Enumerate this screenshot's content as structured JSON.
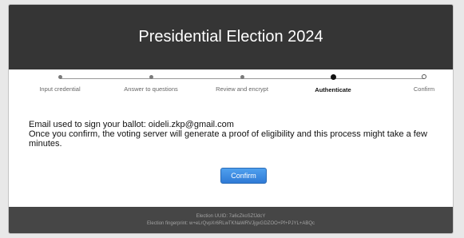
{
  "header": {
    "title": "Presidential Election 2024"
  },
  "steps": [
    {
      "label": "Input credential",
      "state": "done"
    },
    {
      "label": "Answer to questions",
      "state": "done"
    },
    {
      "label": "Review and encrypt",
      "state": "done"
    },
    {
      "label": "Authenticate",
      "state": "active"
    },
    {
      "label": "Confirm",
      "state": "future"
    }
  ],
  "content": {
    "email_line": "Email used to sign your ballot: oideli.zkp@gmail.com",
    "info_line": "Once you confirm, the voting server will generate a proof of eligibility and this process might take a few minutes.",
    "confirm_label": "Confirm"
  },
  "footer": {
    "uuid": "Election UUID: 7a6cZkoSZfJdcY",
    "fingerprint": "Election fingerprint: w+eLrQvpXr6RLwTKNaWRVJjgxGDZOO+Pf+PJYL+ABQc"
  },
  "colors": {
    "header_bg": "#353535",
    "footer_bg": "#464646",
    "button_accent": "#2f7ad6"
  }
}
